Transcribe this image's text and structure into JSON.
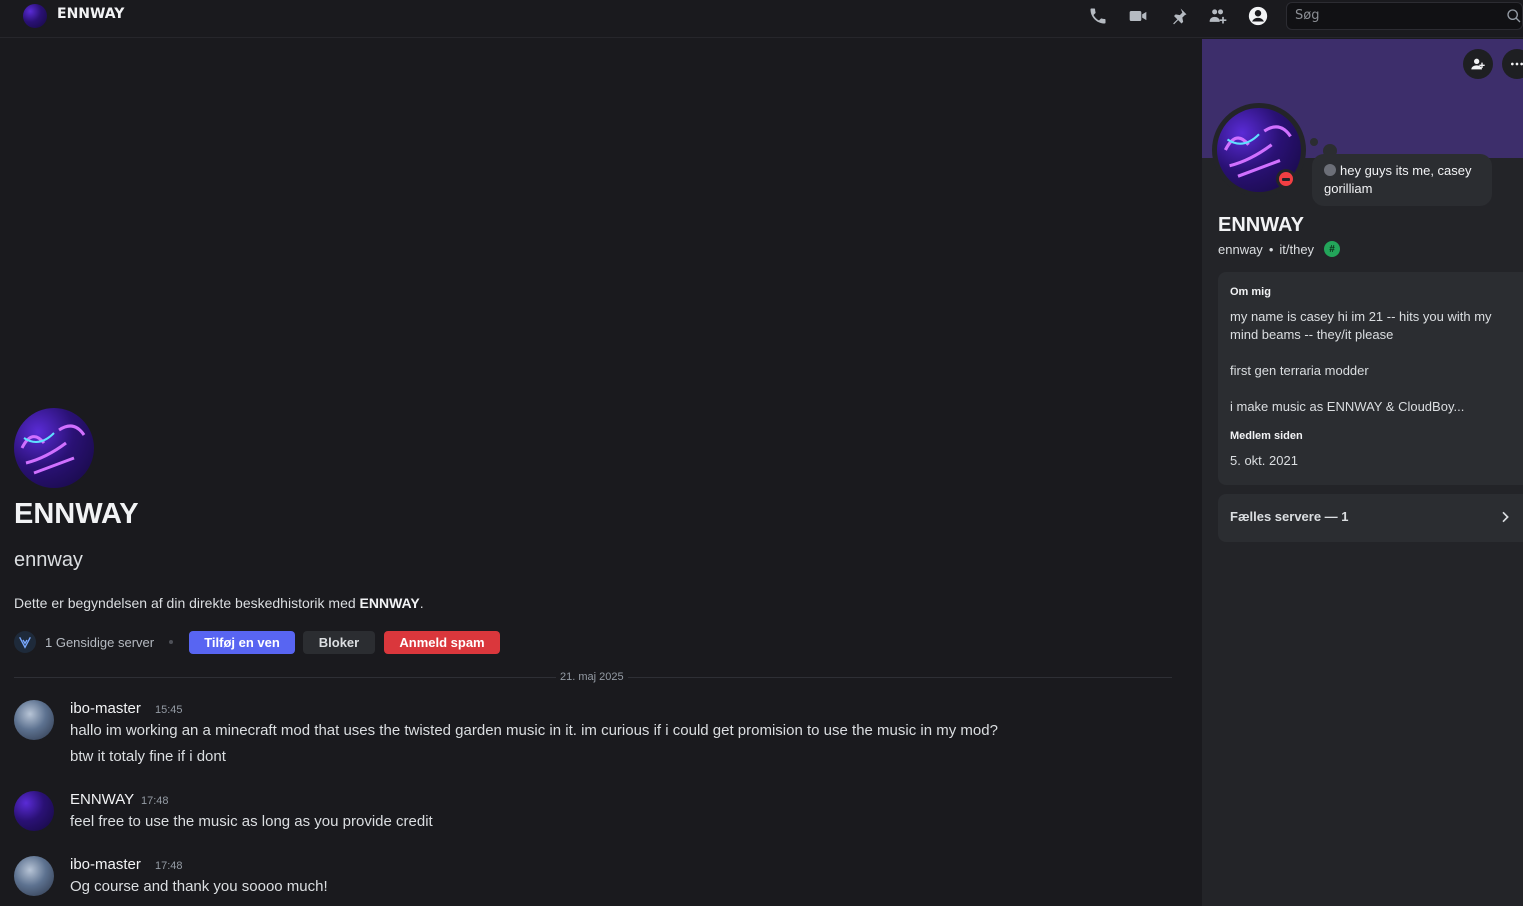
{
  "topbar": {
    "title": "ENNWAY",
    "search_placeholder": "Søg",
    "icons": [
      "phone-icon",
      "video-icon",
      "pin-icon",
      "add-member-icon",
      "profile-icon",
      "search-icon"
    ]
  },
  "intro": {
    "name": "ENNWAY",
    "handle": "ennway",
    "text_prefix": "Dette er begyndelsen af din direkte beskedhistorik med ",
    "text_name": "ENNWAY",
    "text_suffix": ".",
    "mutual_servers": "1 Gensidige server",
    "add_friend": "Tilføj en ven",
    "block": "Bloker",
    "report_spam": "Anmeld spam"
  },
  "date_divider": "21. maj 2025",
  "messages": [
    {
      "author": "ibo-master",
      "time": "15:45",
      "lines": [
        "hallo im working an a minecraft mod that uses the twisted garden music in it. im curious if i could get promision to use the music in my mod?",
        "btw it totaly fine if i dont"
      ]
    },
    {
      "author": "ENNWAY",
      "time": "17:48",
      "lines": [
        "feel free to use the music as long as you provide credit"
      ]
    },
    {
      "author": "ibo-master",
      "time": "17:48",
      "lines": [
        "Og course and thank you soooo much!"
      ]
    }
  ],
  "profile": {
    "status_text": "hey guys its me, casey gorilliam",
    "name": "ENNWAY",
    "handle": "ennway",
    "pronouns": "it/they",
    "badge": "#",
    "about_label": "Om mig",
    "about_lines": [
      "my name is casey hi im 21 -- hits you with my mind beams -- they/it please",
      "first gen terraria modder",
      "i make music as ENNWAY & CloudBoy..."
    ],
    "member_since_label": "Medlem siden",
    "member_since": "5. okt. 2021",
    "mutual_servers": "Fælles servere — 1"
  },
  "colors": {
    "accent": "#5865f2",
    "danger": "#da373c",
    "banner": "#3d2e6b",
    "dnd": "#f23f43",
    "badge": "#23a55a"
  }
}
